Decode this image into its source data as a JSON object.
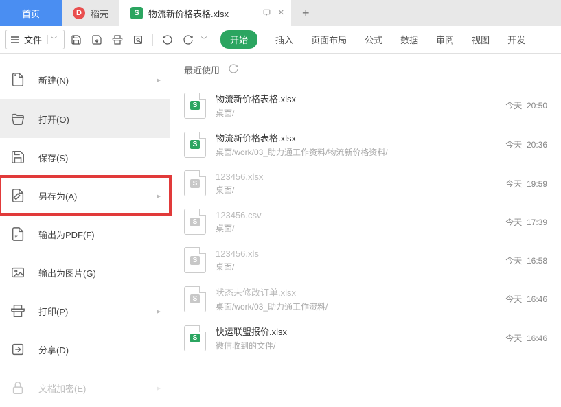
{
  "tabs": {
    "home": "首页",
    "daoke": "稻壳",
    "file": "物流新价格表格.xlsx",
    "plus": "+"
  },
  "toolbar": {
    "file_label": "文件"
  },
  "menu": {
    "start": "开始",
    "insert": "插入",
    "page_layout": "页面布局",
    "formula": "公式",
    "data": "数据",
    "review": "审阅",
    "view": "视图",
    "dev": "开发"
  },
  "sidebar": {
    "new": "新建(N)",
    "open": "打开(O)",
    "save": "保存(S)",
    "save_as": "另存为(A)",
    "export_pdf": "输出为PDF(F)",
    "export_img": "输出为图片(G)",
    "print": "打印(P)",
    "share": "分享(D)",
    "encrypt": "文档加密(E)"
  },
  "recent": {
    "header": "最近使用",
    "items": [
      {
        "name": "物流新价格表格.xlsx",
        "path": "桌面/",
        "day": "今天",
        "time": "20:50",
        "color": "green"
      },
      {
        "name": "物流新价格表格.xlsx",
        "path": "桌面/work/03_助力通工作资料/物流新价格资料/",
        "day": "今天",
        "time": "20:36",
        "color": "green"
      },
      {
        "name": "123456.xlsx",
        "path": "桌面/",
        "day": "今天",
        "time": "19:59",
        "color": "gray",
        "faded": true
      },
      {
        "name": "123456.csv",
        "path": "桌面/",
        "day": "今天",
        "time": "17:39",
        "color": "gray",
        "faded": true
      },
      {
        "name": "123456.xls",
        "path": "桌面/",
        "day": "今天",
        "time": "16:58",
        "color": "gray",
        "faded": true
      },
      {
        "name": "状态未修改订单.xlsx",
        "path": "桌面/work/03_助力通工作资料/",
        "day": "今天",
        "time": "16:46",
        "color": "gray",
        "faded": true
      },
      {
        "name": "快运联盟报价.xlsx",
        "path": "微信收到的文件/",
        "day": "今天",
        "time": "16:46",
        "color": "green"
      }
    ]
  }
}
